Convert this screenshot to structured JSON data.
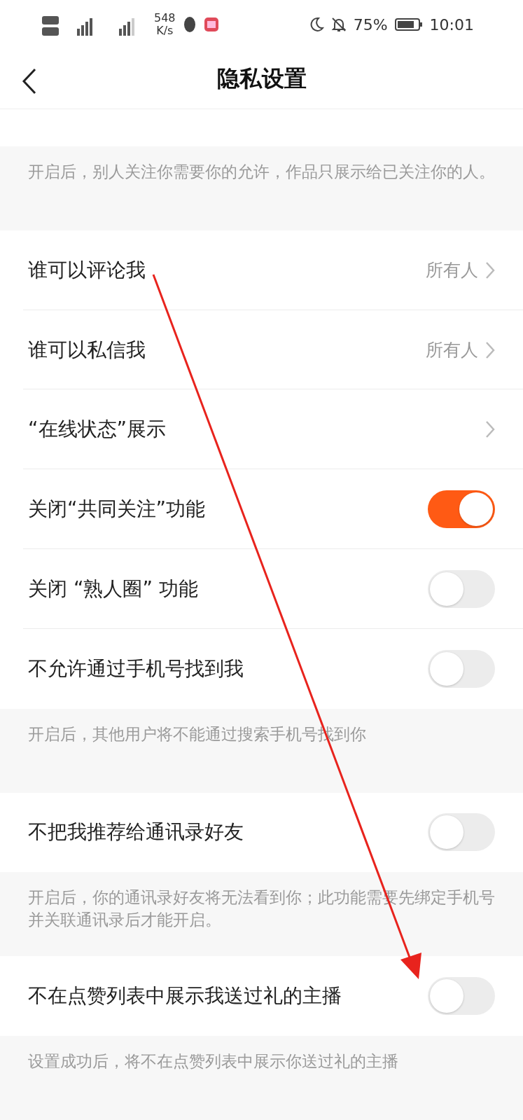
{
  "status_bar": {
    "speed": "548",
    "speed_unit": "K/s",
    "battery": "75%",
    "time": "10:01"
  },
  "header": {
    "title": "隐私设置"
  },
  "items": [
    {
      "kind": "stub"
    },
    {
      "kind": "note",
      "text": "开启后，别人关注你需要你的允许，作品只展示给已关注你的人。"
    },
    {
      "kind": "link",
      "label": "谁可以评论我",
      "value": "所有人"
    },
    {
      "kind": "link",
      "label": "谁可以私信我",
      "value": "所有人"
    },
    {
      "kind": "link",
      "label": "“在线状态”展示"
    },
    {
      "kind": "toggle",
      "label": "关闭“共同关注”功能",
      "on": true
    },
    {
      "kind": "toggle",
      "label": "关闭 “熟人圈” 功能",
      "on": false
    },
    {
      "kind": "toggle",
      "label": "不允许通过手机号找到我",
      "on": false
    },
    {
      "kind": "note",
      "text": "开启后，其他用户将不能通过搜索手机号找到你"
    },
    {
      "kind": "toggle",
      "label": "不把我推荐给通讯录好友",
      "on": false
    },
    {
      "kind": "note",
      "text": "开启后，你的通讯录好友将无法看到你；此功能需要先绑定手机号并关联通讯录后才能开启。"
    },
    {
      "kind": "toggle",
      "label": "不在点赞列表中展示我送过礼的主播",
      "on": false
    },
    {
      "kind": "note",
      "text": "设置成功后，将不在点赞列表中展示你送过礼的主播"
    }
  ]
}
